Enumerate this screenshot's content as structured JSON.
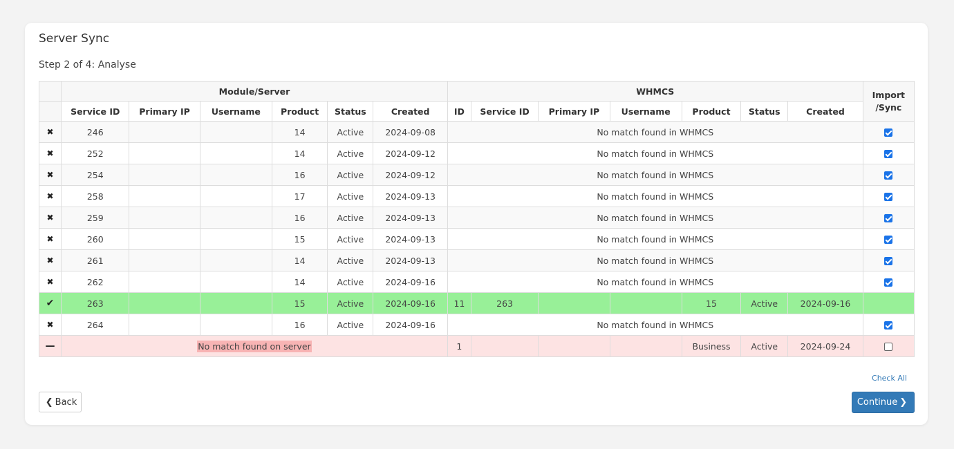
{
  "title": "Server Sync",
  "step": "Step 2 of 4: Analyse",
  "table": {
    "group_headers": {
      "module": "Module/Server",
      "whmcs": "WHMCS",
      "import": "Import /Sync"
    },
    "module_columns": [
      "Service ID",
      "Primary IP",
      "Username",
      "Product",
      "Status",
      "Created"
    ],
    "whmcs_columns": [
      "ID",
      "Service ID",
      "Primary IP",
      "Username",
      "Product",
      "Status",
      "Created"
    ],
    "no_match_whmcs": "No match found in WHMCS",
    "no_match_server": "No match found on server",
    "rows": [
      {
        "icon": "x-icon",
        "service_id": "246",
        "primary_ip": "",
        "username": "",
        "product": "14",
        "status": "Active",
        "created": "2024-09-08",
        "whmcs": null,
        "checked": true
      },
      {
        "icon": "x-icon",
        "service_id": "252",
        "primary_ip": "",
        "username": "",
        "product": "14",
        "status": "Active",
        "created": "2024-09-12",
        "whmcs": null,
        "checked": true
      },
      {
        "icon": "x-icon",
        "service_id": "254",
        "primary_ip": "",
        "username": "",
        "product": "16",
        "status": "Active",
        "created": "2024-09-12",
        "whmcs": null,
        "checked": true
      },
      {
        "icon": "x-icon",
        "service_id": "258",
        "primary_ip": "",
        "username": "",
        "product": "17",
        "status": "Active",
        "created": "2024-09-13",
        "whmcs": null,
        "checked": true
      },
      {
        "icon": "x-icon",
        "service_id": "259",
        "primary_ip": "",
        "username": "",
        "product": "16",
        "status": "Active",
        "created": "2024-09-13",
        "whmcs": null,
        "checked": true
      },
      {
        "icon": "x-icon",
        "service_id": "260",
        "primary_ip": "",
        "username": "",
        "product": "15",
        "status": "Active",
        "created": "2024-09-13",
        "whmcs": null,
        "checked": true
      },
      {
        "icon": "x-icon",
        "service_id": "261",
        "primary_ip": "",
        "username": "",
        "product": "14",
        "status": "Active",
        "created": "2024-09-13",
        "whmcs": null,
        "checked": true
      },
      {
        "icon": "x-icon",
        "service_id": "262",
        "primary_ip": "",
        "username": "",
        "product": "14",
        "status": "Active",
        "created": "2024-09-16",
        "whmcs": null,
        "checked": true
      },
      {
        "icon": "check-icon",
        "type": "match",
        "service_id": "263",
        "primary_ip": "",
        "username": "",
        "product": "15",
        "status": "Active",
        "created": "2024-09-16",
        "whmcs": {
          "id": "11",
          "service_id": "263",
          "primary_ip": "",
          "username": "",
          "product": "15",
          "status": "Active",
          "created": "2024-09-16"
        },
        "checked": null
      },
      {
        "icon": "x-icon",
        "service_id": "264",
        "primary_ip": "",
        "username": "",
        "product": "16",
        "status": "Active",
        "created": "2024-09-16",
        "whmcs": null,
        "checked": true
      },
      {
        "icon": "minus-icon",
        "type": "nomatch",
        "server": null,
        "whmcs": {
          "id": "1",
          "service_id": "",
          "primary_ip": "",
          "username": "",
          "product": "Business",
          "status": "Active",
          "created": "2024-09-24"
        },
        "checked": false
      }
    ]
  },
  "check_all": "Check All",
  "back_label": "Back",
  "continue_label": "Continue"
}
